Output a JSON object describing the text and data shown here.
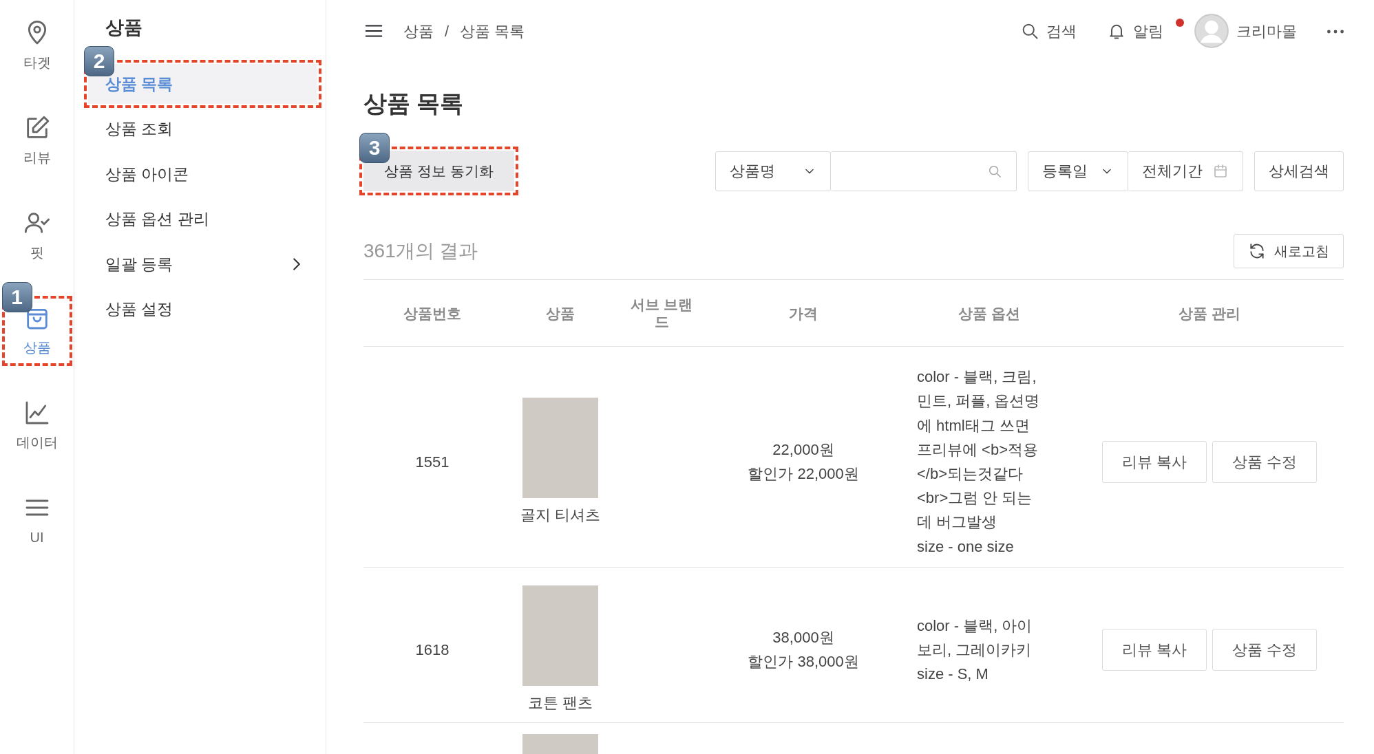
{
  "rail": [
    {
      "label": "타겟",
      "selected": false
    },
    {
      "label": "리뷰",
      "selected": false
    },
    {
      "label": "핏",
      "selected": false
    },
    {
      "label": "상품",
      "selected": true,
      "callout": "1"
    },
    {
      "label": "데이터",
      "selected": false
    },
    {
      "label": "UI",
      "selected": false
    }
  ],
  "sidebar": {
    "title": "상품",
    "items": [
      {
        "label": "상품 목록",
        "selected": true,
        "submenu": false,
        "callout": "2"
      },
      {
        "label": "상품 조회",
        "selected": false,
        "submenu": false
      },
      {
        "label": "상품 아이콘",
        "selected": false,
        "submenu": false
      },
      {
        "label": "상품 옵션 관리",
        "selected": false,
        "submenu": false
      },
      {
        "label": "일괄 등록",
        "selected": false,
        "submenu": true
      },
      {
        "label": "상품 설정",
        "selected": false,
        "submenu": false
      }
    ]
  },
  "topbar": {
    "breadcrumb": [
      "상품",
      "상품 목록"
    ],
    "separator": "/",
    "search": "검색",
    "alerts": "알림",
    "unread": true,
    "user": "크리마몰"
  },
  "page_title": "상품 목록",
  "toolbar": {
    "sync_button": "상품 정보 동기화",
    "sync_callout": "3",
    "search_select": "상품명",
    "date_select": "등록일",
    "date_range": "전체기간",
    "detail_button": "상세검색"
  },
  "results": {
    "count": "361개의 결과",
    "refresh": "새로고침"
  },
  "table": {
    "columns": [
      "상품번호",
      "상품",
      "서브 브랜드",
      "가격",
      "상품 옵션",
      "상품 관리"
    ],
    "rows": [
      {
        "kind": "full",
        "number": "1551",
        "name": "골지 티셔츠",
        "price": "22,000원",
        "discount": "할인가 22,000원",
        "options": [
          "color - 블랙, 크림, 민트, 퍼플, 옵션명에 html태그 쓰면 프리뷰에 <b>적용</b>되는것같다<br>그럼 안 되는데 버그발생",
          "size - one size"
        ],
        "actions": [
          "리뷰 복사",
          "상품 수정"
        ]
      },
      {
        "kind": "full",
        "number": "1618",
        "name": "코튼 팬츠",
        "price": "38,000원",
        "discount": "할인가 38,000원",
        "options": [
          "color - 블랙, 아이보리, 그레이카키",
          "size - S, M"
        ],
        "actions": [
          "리뷰 복사",
          "상품 수정"
        ]
      },
      {
        "kind": "partial"
      }
    ]
  }
}
